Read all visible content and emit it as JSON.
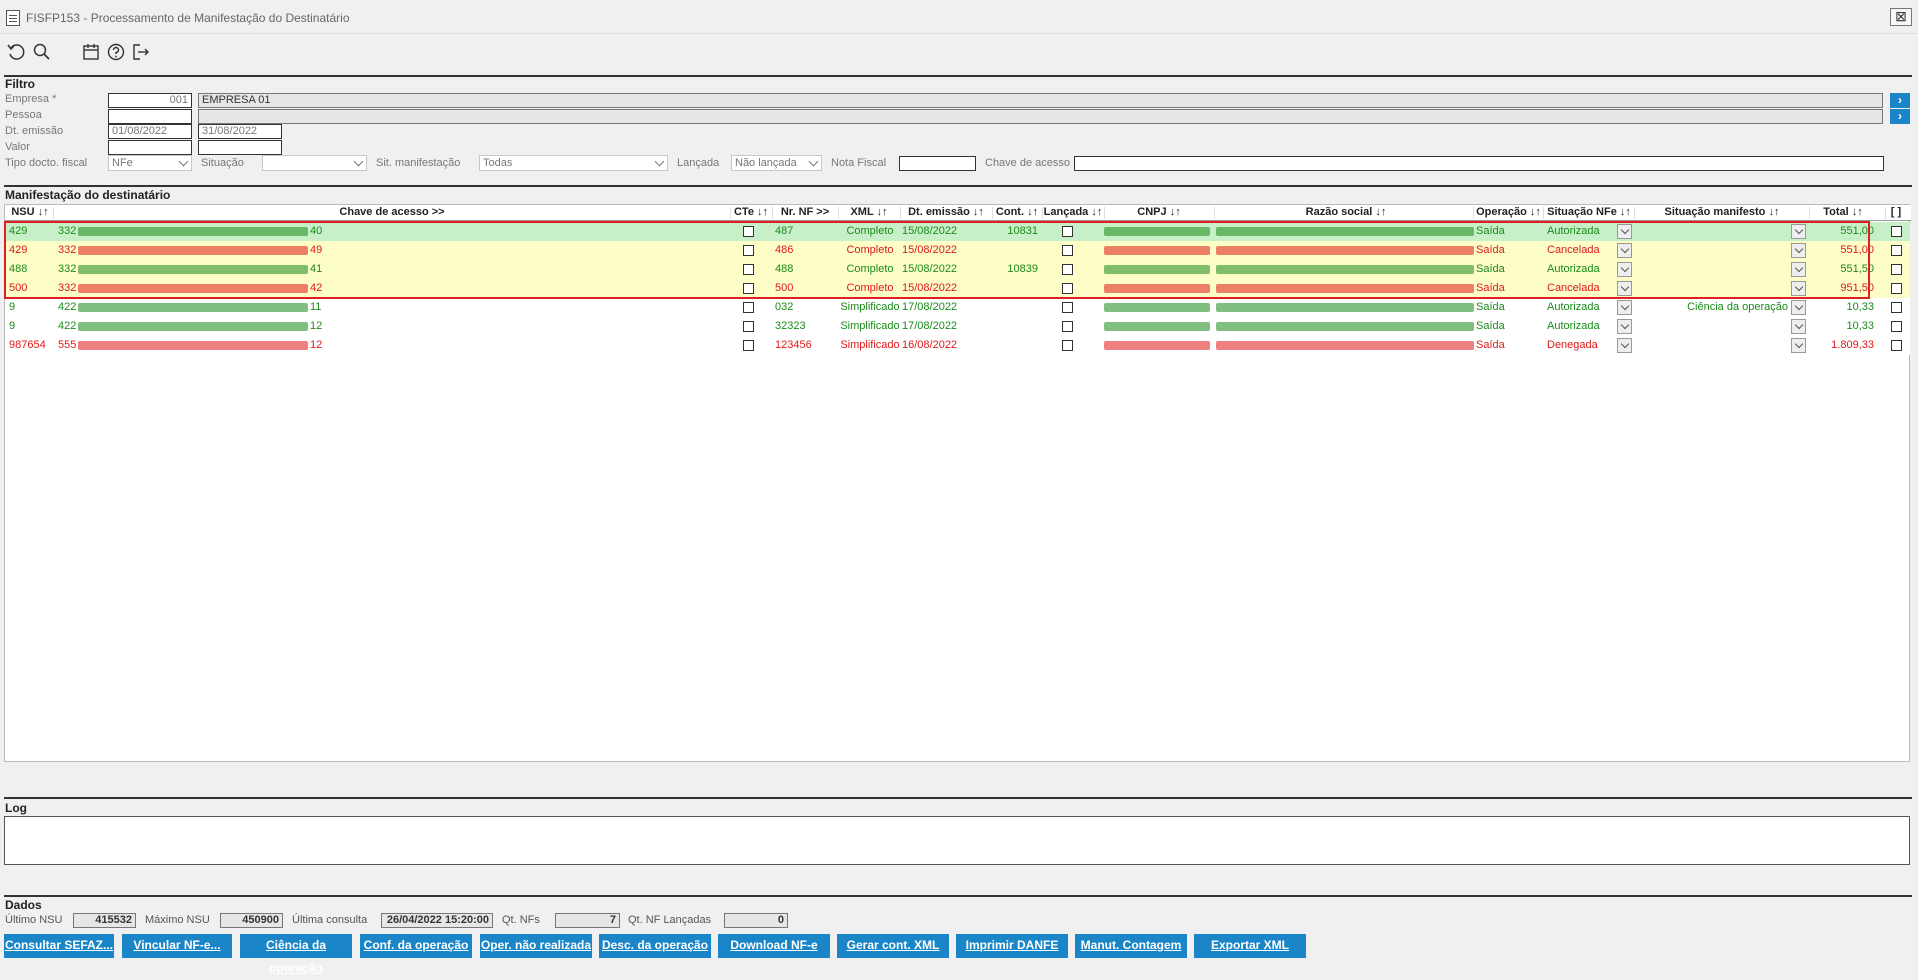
{
  "window": {
    "title": "FISFP153 - Processamento de Manifestação do Destinatário",
    "close": "⊠"
  },
  "toolbar": {
    "icons": [
      "refresh-icon",
      "search-icon",
      "calendar-icon",
      "help-icon",
      "exit-icon"
    ]
  },
  "filter": {
    "title": "Filtro",
    "empresa_label": "Empresa *",
    "empresa_code": "001",
    "empresa_name": "EMPRESA 01",
    "pessoa_label": "Pessoa",
    "pessoa_code": "",
    "pessoa_name": "",
    "dt_emissao_label": "Dt. emissão",
    "dt_from": "01/08/2022",
    "dt_to": "31/08/2022",
    "valor_label": "Valor",
    "valor_from": "",
    "valor_to": "",
    "tipo_label": "Tipo docto. fiscal",
    "tipo_value": "NFe",
    "situacao_label": "Situação",
    "situacao_value": "",
    "sit_manif_label": "Sit. manifestação",
    "sit_manif_value": "Todas",
    "lancada_label": "Lançada",
    "lancada_value": "Não lançada",
    "nota_label": "Nota Fiscal",
    "nota_value": "",
    "chave_label": "Chave de acesso",
    "chave_value": "",
    "go": "›"
  },
  "grid": {
    "title": "Manifestação do destinatário",
    "columns": [
      "NSU ↓↑",
      "Chave de acesso >>",
      "CTe ↓↑",
      "Nr. NF >>",
      "XML ↓↑",
      "Dt. emissão ↓↑",
      "Cont. ↓↑",
      "Lançada ↓↑",
      "CNPJ ↓↑",
      "Razão social ↓↑",
      "Operação ↓↑",
      "Situação NFe ↓↑",
      "Situação manifesto ↓↑",
      "Total ↓↑",
      "[ ]"
    ],
    "rows": [
      {
        "nsu": "429",
        "key_start": "332",
        "key_end": "40",
        "nr": "487",
        "xml": "Completo",
        "dt": "15/08/2022",
        "cont": "10831",
        "op": "Saída",
        "sit": "Autorizada",
        "manif": "",
        "total": "551,00",
        "color": "#1a8a1a",
        "bg": "#c8f0c8"
      },
      {
        "nsu": "429",
        "key_start": "332",
        "key_end": "49",
        "nr": "486",
        "xml": "Completo",
        "dt": "15/08/2022",
        "cont": "",
        "op": "Saída",
        "sit": "Cancelada",
        "manif": "",
        "total": "551,00",
        "color": "#e01818",
        "bg": "#fdfdc8"
      },
      {
        "nsu": "488",
        "key_start": "332",
        "key_end": "41",
        "nr": "488",
        "xml": "Completo",
        "dt": "15/08/2022",
        "cont": "10839",
        "op": "Saída",
        "sit": "Autorizada",
        "manif": "",
        "total": "551,50",
        "color": "#1a8a1a",
        "bg": "#fdfdc8"
      },
      {
        "nsu": "500",
        "key_start": "332",
        "key_end": "42",
        "nr": "500",
        "xml": "Completo",
        "dt": "15/08/2022",
        "cont": "",
        "op": "Saída",
        "sit": "Cancelada",
        "manif": "",
        "total": "951,50",
        "color": "#e01818",
        "bg": "#fdfdc8"
      },
      {
        "nsu": "9",
        "key_start": "422",
        "key_end": "11",
        "nr": "032",
        "xml": "Simplificado",
        "dt": "17/08/2022",
        "cont": "",
        "op": "Saída",
        "sit": "Autorizada",
        "manif": "Ciência da operação",
        "total": "10,33",
        "color": "#1a8a1a",
        "bg": "#ffffff"
      },
      {
        "nsu": "9",
        "key_start": "422",
        "key_end": "12",
        "nr": "32323",
        "xml": "Simplificado",
        "dt": "17/08/2022",
        "cont": "",
        "op": "Saída",
        "sit": "Autorizada",
        "manif": "",
        "total": "10,33",
        "color": "#1a8a1a",
        "bg": "#ffffff"
      },
      {
        "nsu": "987654",
        "key_start": "555",
        "key_end": "12",
        "nr": "123456",
        "xml": "Simplificado",
        "dt": "16/08/2022",
        "cont": "",
        "op": "Saída",
        "sit": "Denegada",
        "manif": "",
        "total": "1.809,33",
        "color": "#e01818",
        "bg": "#ffffff"
      }
    ]
  },
  "log": {
    "title": "Log"
  },
  "dados": {
    "title": "Dados",
    "ultimo_label": "Último NSU",
    "ultimo": "415532",
    "maximo_label": "Máximo NSU",
    "maximo": "450900",
    "consulta_label": "Última consulta",
    "consulta": "26/04/2022 15:20:00",
    "qtnf_label": "Qt. NFs",
    "qtnf": "7",
    "qtlanc_label": "Qt. NF Lançadas",
    "qtlanc": "0"
  },
  "buttons": [
    "Consultar SEFAZ...",
    "Vincular NF-e...",
    "Ciência da operação",
    "Conf. da operação",
    "Oper. não realizada",
    "Desc. da operação",
    "Download NF-e",
    "Gerar cont. XML",
    "Imprimir DANFE",
    "Manut. Contagem",
    "Exportar XML"
  ],
  "colors": {
    "accent": "#1a86c8",
    "ok": "#1a8a1a",
    "error": "#e01818",
    "highlight": "#e02020"
  }
}
